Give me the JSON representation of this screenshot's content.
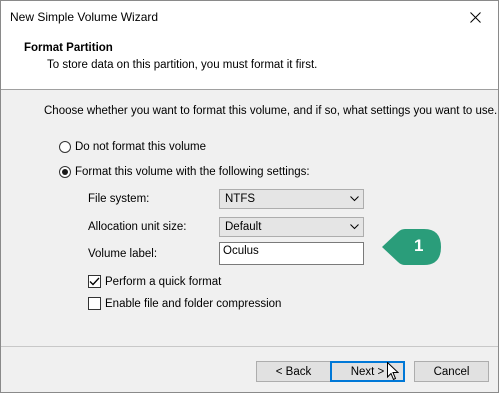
{
  "window": {
    "title": "New Simple Volume Wizard"
  },
  "header": {
    "title": "Format Partition",
    "subtitle": "To store data on this partition, you must format it first."
  },
  "content": {
    "instruction": "Choose whether you want to format this volume, and if so, what settings you want to use.",
    "radio_no_format": {
      "label": "Do not format this volume",
      "checked": false
    },
    "radio_format": {
      "label": "Format this volume with the following settings:",
      "checked": true
    },
    "file_system": {
      "label": "File system:",
      "value": "NTFS"
    },
    "allocation_unit": {
      "label": "Allocation unit size:",
      "value": "Default"
    },
    "volume_label": {
      "label": "Volume label:",
      "value": "Oculus"
    },
    "quick_format": {
      "label": "Perform a quick format",
      "checked": true
    },
    "compression": {
      "label": "Enable file and folder compression",
      "checked": false
    }
  },
  "footer": {
    "back": "< Back",
    "next": "Next >",
    "cancel": "Cancel"
  },
  "callout": {
    "number": "1",
    "color": "#2a9d7a"
  }
}
